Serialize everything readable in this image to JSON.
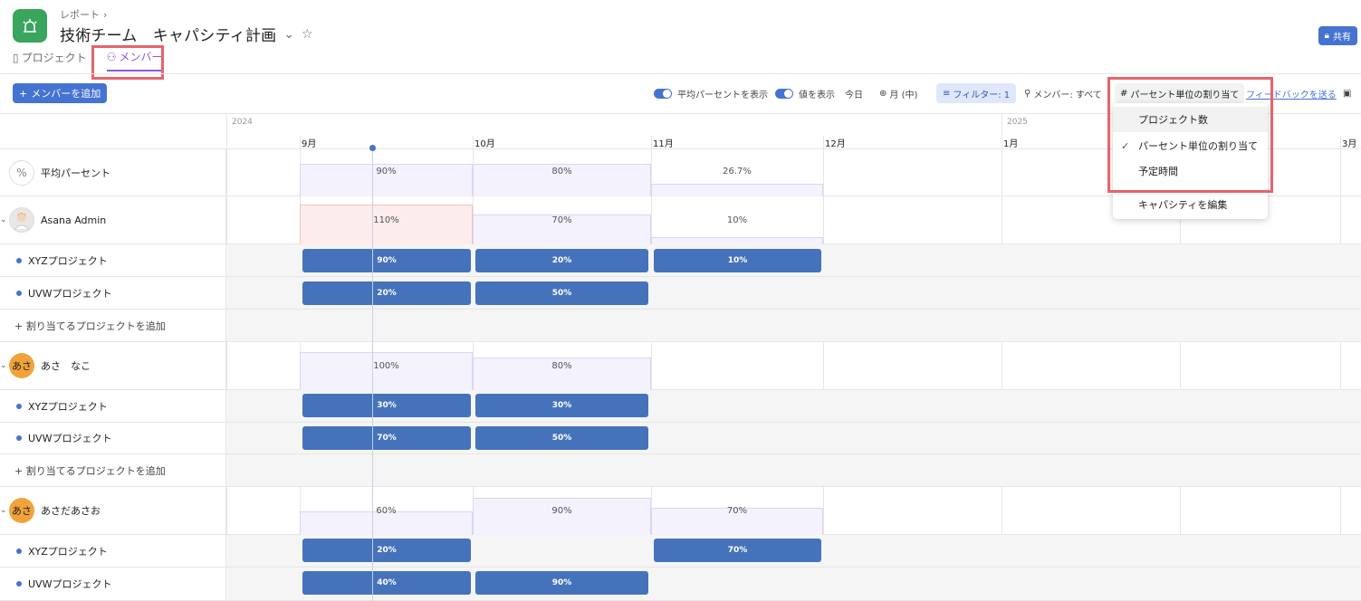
{
  "header": {
    "breadcrumb": "レポート",
    "title": "技術チーム　キャパシティ計画",
    "share_label": "共有"
  },
  "tabs": {
    "projects": "プロジェクト",
    "members": "メンバー"
  },
  "toolbar": {
    "add_member": "メンバーを追加",
    "show_avg_pct": "平均パーセントを表示",
    "show_values": "値を表示",
    "today": "今日",
    "zoom": "月 (中)",
    "filter": "フィルター: 1",
    "member_filter": "メンバー: すべて",
    "pct_assign": "パーセント単位の割り当て",
    "feedback": "フィードバックを送る"
  },
  "timeline": {
    "years": [
      "2024",
      "2025"
    ],
    "months": [
      "9月",
      "10月",
      "11月",
      "12月",
      "1月",
      "3月"
    ]
  },
  "rows": {
    "avg": {
      "label": "平均パーセント",
      "icon": "%",
      "values": [
        "90%",
        "80%",
        "26.7%"
      ]
    },
    "m1": {
      "name": "Asana Admin",
      "values": [
        "110%",
        "70%",
        "10%"
      ]
    },
    "m1p1": {
      "name": "XYZプロジェクト",
      "bars": [
        "90%",
        "20%",
        "10%"
      ]
    },
    "m1p2": {
      "name": "UVWプロジェクト",
      "bars": [
        "20%",
        "50%"
      ]
    },
    "add1": "+ 割り当てるプロジェクトを追加",
    "m2": {
      "name": "あさ　なこ",
      "avatar": "あさ",
      "values": [
        "100%",
        "80%"
      ]
    },
    "m2p1": {
      "name": "XYZプロジェクト",
      "bars": [
        "30%",
        "30%"
      ]
    },
    "m2p2": {
      "name": "UVWプロジェクト",
      "bars": [
        "70%",
        "50%"
      ]
    },
    "add2": "+ 割り当てるプロジェクトを追加",
    "m3": {
      "name": "あさだあさお",
      "avatar": "あさ",
      "values": [
        "60%",
        "90%",
        "70%"
      ]
    },
    "m3p1": {
      "name": "XYZプロジェクト",
      "bars": [
        "20%",
        "70%"
      ]
    },
    "m3p2": {
      "name": "UVWプロジェクト",
      "bars": [
        "40%",
        "90%"
      ]
    }
  },
  "menu": {
    "items": [
      "プロジェクト数",
      "パーセント単位の割り当て",
      "予定時間",
      "キャパシティを編集"
    ]
  },
  "colors": {
    "accent": "#4573d2",
    "bar": "#4573bb",
    "highlight": "#e8636b",
    "brand_green": "#3aa55d"
  }
}
